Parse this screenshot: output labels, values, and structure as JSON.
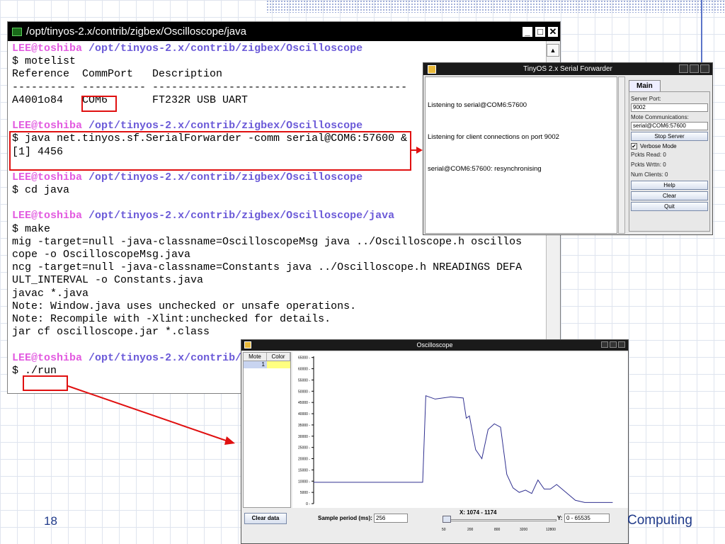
{
  "slide": {
    "number": "18",
    "footer": "Computing"
  },
  "terminal": {
    "title": "/opt/tinyos-2.x/contrib/zigbex/Oscilloscope/java",
    "lines": [
      {
        "user": "LEE@toshiba",
        "path": "/opt/tinyos-2.x/contrib/zigbex/Oscilloscope"
      },
      {
        "text": "$ motelist"
      },
      {
        "text": "Reference  CommPort   Description"
      },
      {
        "text": "---------- ---------- ----------------------------------------"
      },
      {
        "text": "A4001o84   COM6       FT232R USB UART"
      },
      {
        "text": ""
      },
      {
        "user": "LEE@toshiba",
        "path": "/opt/tinyos-2.x/contrib/zigbex/Oscilloscope"
      },
      {
        "text": "$ java net.tinyos.sf.SerialForwarder -comm serial@COM6:57600 &"
      },
      {
        "text": "[1] 4456"
      },
      {
        "text": ""
      },
      {
        "user": "LEE@toshiba",
        "path": "/opt/tinyos-2.x/contrib/zigbex/Oscilloscope"
      },
      {
        "text": "$ cd java"
      },
      {
        "text": ""
      },
      {
        "user": "LEE@toshiba",
        "path": "/opt/tinyos-2.x/contrib/zigbex/Oscilloscope/java"
      },
      {
        "text": "$ make"
      },
      {
        "text": "mig -target=null -java-classname=OscilloscopeMsg java ../Oscilloscope.h oscillos"
      },
      {
        "text": "cope -o OscilloscopeMsg.java"
      },
      {
        "text": "ncg -target=null -java-classname=Constants java ../Oscilloscope.h NREADINGS DEFA"
      },
      {
        "text": "ULT_INTERVAL -o Constants.java"
      },
      {
        "text": "javac *.java"
      },
      {
        "text": "Note: Window.java uses unchecked or unsafe operations."
      },
      {
        "text": "Note: Recompile with -Xlint:unchecked for details."
      },
      {
        "text": "jar cf oscilloscope.jar *.class"
      },
      {
        "text": ""
      },
      {
        "user": "LEE@toshiba",
        "path": "/opt/tinyos-2.x/contrib/zigbex/Oscilloscope/java"
      },
      {
        "text": "$ ./run"
      }
    ]
  },
  "serial_forwarder": {
    "title": "TinyOS 2.x Serial Forwarder",
    "log": [
      "Listening to serial@COM6:57600",
      "Listening for client connections on port 9002",
      "serial@COM6:57600: resynchronising"
    ],
    "tab": "Main",
    "server_port_label": "Server Port:",
    "server_port": "9002",
    "mote_comm_label": "Mote Communications:",
    "mote_comm": "serial@COM6:57600",
    "stop_button": "Stop Server",
    "verbose_label": "Verbose Mode",
    "verbose_checked": true,
    "pckts_read": "Pckts Read: 0",
    "pckts_wrttn": "Pckts Wrttn: 0",
    "num_clients": "Num Clients: 0",
    "help_button": "Help",
    "clear_button": "Clear",
    "quit_button": "Quit"
  },
  "oscilloscope": {
    "title": "Oscilloscope",
    "table_headers": [
      "Mote",
      "Color"
    ],
    "rows": [
      {
        "mote": "1",
        "color": "#ffff80"
      }
    ],
    "clear_button": "Clear data",
    "sample_label": "Sample period (ms):",
    "sample_value": "256",
    "x_label": "X: 1074 - 1174",
    "y_label": "Y:",
    "y_value": "0 - 65535",
    "slider_ticks": [
      "50",
      "200",
      "800",
      "3200",
      "12800"
    ],
    "line_color": "#303090"
  },
  "chart_data": {
    "type": "line",
    "title": "",
    "xlabel": "",
    "ylabel": "",
    "ylim": [
      0,
      65535
    ],
    "yticks": [
      0,
      5000,
      10000,
      15000,
      20000,
      25000,
      30000,
      35000,
      40000,
      45000,
      50000,
      55000,
      60000,
      65000
    ],
    "xlim": [
      1074,
      1174
    ],
    "series": [
      {
        "x": [
          1074,
          1084,
          1094,
          1104,
          1109,
          1110,
          1113,
          1118,
          1122,
          1123,
          1124,
          1126,
          1128,
          1130,
          1132,
          1134,
          1136,
          1138,
          1140,
          1142,
          1144,
          1146,
          1148,
          1150,
          1152,
          1155,
          1158,
          1161,
          1166,
          1170
        ],
        "y": [
          9500,
          9500,
          9500,
          9500,
          9500,
          48000,
          46500,
          47500,
          47000,
          38000,
          39000,
          24000,
          20000,
          33000,
          35500,
          34000,
          13000,
          7000,
          5000,
          6000,
          4500,
          10500,
          6500,
          6500,
          8500,
          5000,
          1500,
          500,
          500,
          500
        ]
      }
    ]
  }
}
